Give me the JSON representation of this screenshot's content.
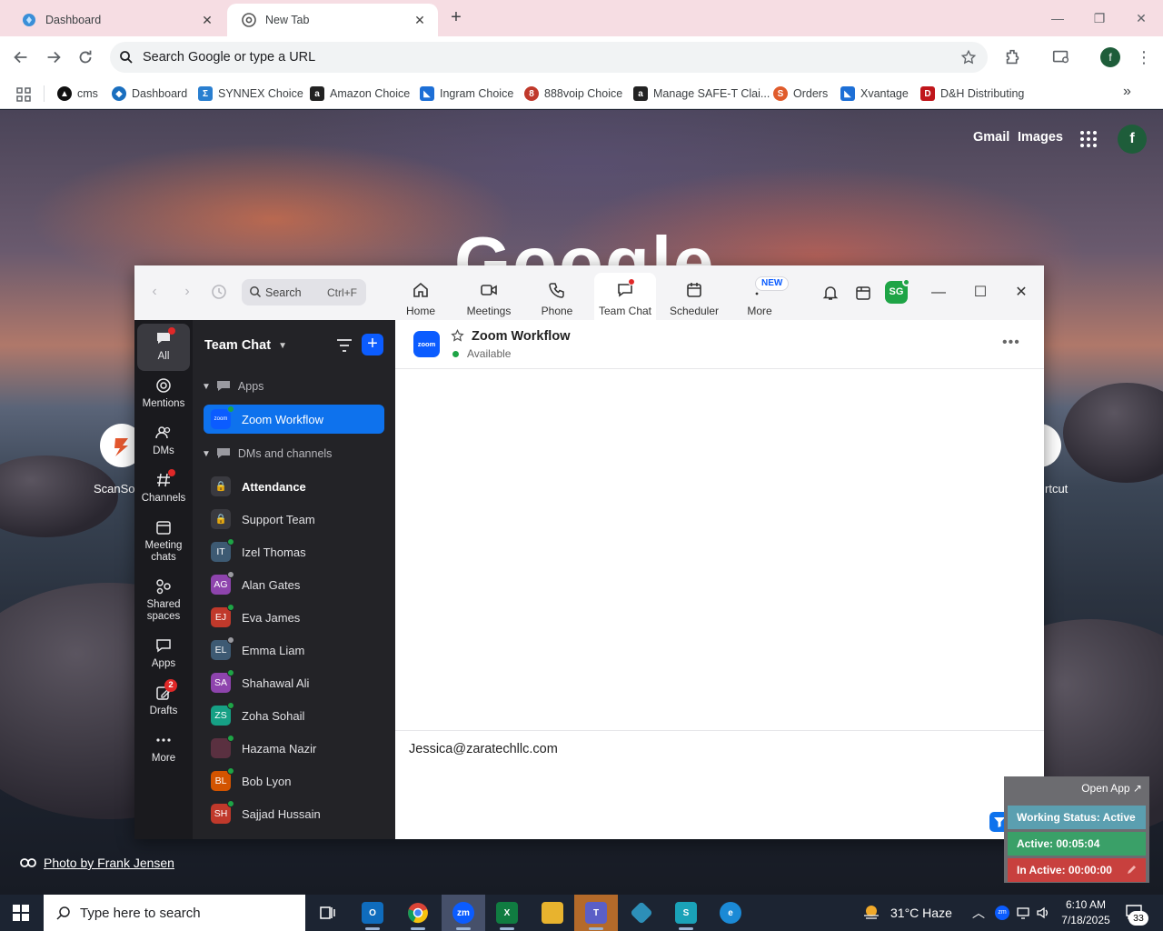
{
  "browser": {
    "tabs": [
      {
        "title": "Dashboard",
        "active": false
      },
      {
        "title": "New Tab",
        "active": true
      }
    ],
    "omnibox_placeholder": "Search Google or type a URL",
    "profile_initial": "f",
    "bookmarks": [
      {
        "label": "cms",
        "color": "#111111",
        "icon": "triangle-icon"
      },
      {
        "label": "Dashboard",
        "color": "#1a6fbf",
        "icon": "diamond-icon"
      },
      {
        "label": "SYNNEX Choice",
        "color": "#2a7fd0",
        "icon": "synnex-icon"
      },
      {
        "label": "Amazon Choice",
        "color": "#222222",
        "icon": "amazon-icon"
      },
      {
        "label": "Ingram Choice",
        "color": "#1d6fd6",
        "icon": "ingram-icon"
      },
      {
        "label": "888voip Choice",
        "color": "#c0392b",
        "icon": "888voip-icon"
      },
      {
        "label": "Manage SAFE-T Clai...",
        "color": "#222222",
        "icon": "amazon-icon"
      },
      {
        "label": "Orders",
        "color": "#e05c2c",
        "icon": "orders-icon"
      },
      {
        "label": "Xvantage",
        "color": "#1d6fd6",
        "icon": "xvantage-icon"
      },
      {
        "label": "D&H Distributing",
        "color": "#c0161b",
        "icon": "dh-icon"
      }
    ]
  },
  "ntp": {
    "links": [
      "Gmail",
      "Images"
    ],
    "avatar_initial": "f",
    "logo_text": "Google",
    "shortcuts": [
      "ScanSou",
      "rtcut"
    ],
    "photo_credit": "Photo by Frank Jensen"
  },
  "zoom": {
    "search_placeholder": "Search",
    "search_shortcut": "Ctrl+F",
    "tabs": [
      {
        "label": "Home",
        "icon": "home-icon"
      },
      {
        "label": "Meetings",
        "icon": "video-icon"
      },
      {
        "label": "Phone",
        "icon": "phone-icon"
      },
      {
        "label": "Team Chat",
        "icon": "chat-icon",
        "active": true
      },
      {
        "label": "Scheduler",
        "icon": "calendar-icon"
      },
      {
        "label": "More",
        "icon": "more-icon"
      }
    ],
    "new_badge": "NEW",
    "avatar_initials": "SG",
    "rail": [
      {
        "label": "All"
      },
      {
        "label": "Mentions"
      },
      {
        "label": "DMs"
      },
      {
        "label": "Channels"
      },
      {
        "label": "Meeting chats"
      },
      {
        "label": "Shared spaces"
      },
      {
        "label": "Apps"
      },
      {
        "label": "Drafts",
        "badge": "2"
      },
      {
        "label": "More"
      }
    ],
    "list": {
      "title": "Team Chat",
      "apps_section": "Apps",
      "apps": [
        {
          "name": "Zoom Workflow"
        }
      ],
      "dms_section": "DMs and channels",
      "channels": [
        {
          "name": "Attendance",
          "bold": true
        },
        {
          "name": "Support Team",
          "bold": false
        }
      ],
      "contacts": [
        {
          "initials": "IT",
          "name": "Izel Thomas",
          "color": "#3d5a73",
          "status": "#1ea446"
        },
        {
          "initials": "AG",
          "name": "Alan Gates",
          "color": "#8e44ad",
          "status": "#9a9aa0"
        },
        {
          "initials": "EJ",
          "name": "Eva James",
          "color": "#c0392b",
          "status": "#1ea446"
        },
        {
          "initials": "EL",
          "name": "Emma Liam",
          "color": "#3d5a73",
          "status": "#9a9aa0"
        },
        {
          "initials": "SA",
          "name": "Shahawal Ali",
          "color": "#8e44ad",
          "status": "#1ea446"
        },
        {
          "initials": "ZS",
          "name": "Zoha Sohail",
          "color": "#16a085",
          "status": "#1ea446"
        },
        {
          "initials": "",
          "name": "Hazama Nazir",
          "color": "#5a3040",
          "status": "#1ea446"
        },
        {
          "initials": "BL",
          "name": "Bob Lyon",
          "color": "#d35400",
          "status": "#1ea446"
        },
        {
          "initials": "SH",
          "name": "Sajjad Hussain",
          "color": "#c0392b",
          "status": "#1ea446"
        }
      ]
    },
    "chat": {
      "title": "Zoom Workflow",
      "logo_text": "zoom",
      "status": "Available",
      "composer_text": "Jessica@zaratechllc.com"
    }
  },
  "working_status": {
    "open_app": "Open App ↗",
    "status": "Working Status: Active",
    "active": "Active: 00:05:04",
    "inactive": "In Active: 00:00:00"
  },
  "taskbar": {
    "search_placeholder": "Type here to search",
    "weather": "31°C  Haze",
    "time": "6:10 AM",
    "date": "7/18/2025",
    "notifications": "33"
  },
  "colors": {
    "zoom_blue": "#0b5cff",
    "selected_row": "#0e72ed",
    "online_green": "#1ea446"
  }
}
